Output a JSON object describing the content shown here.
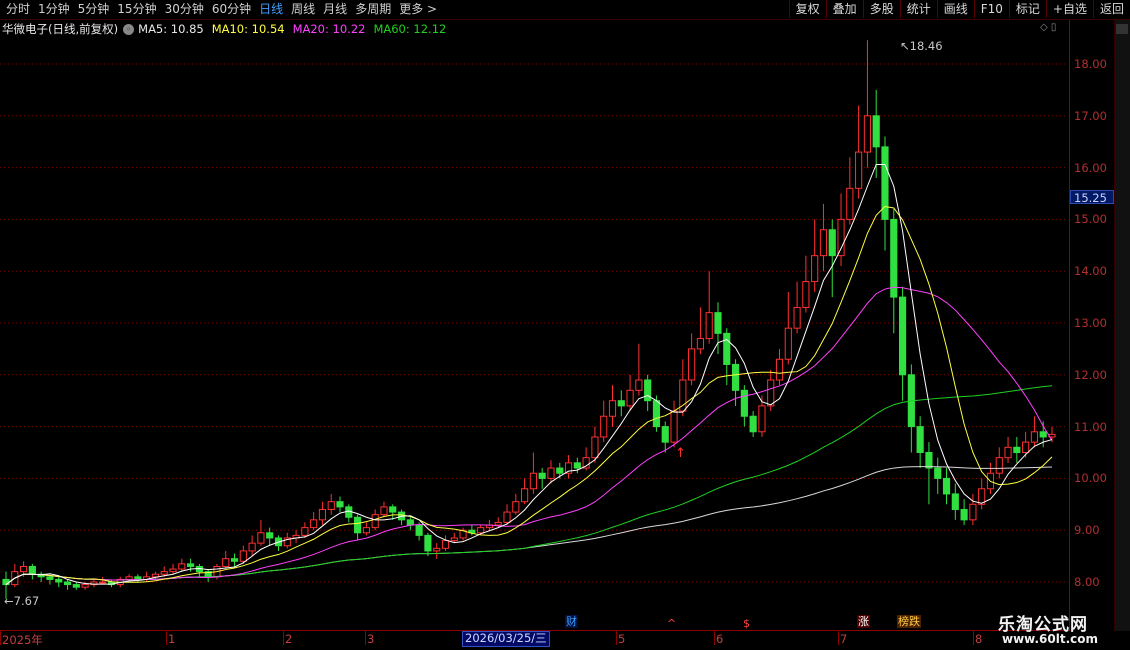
{
  "toolbar": {
    "periods": [
      "分时",
      "1分钟",
      "5分钟",
      "15分钟",
      "30分钟",
      "60分钟",
      "日线",
      "周线",
      "月线",
      "多周期",
      "更多 >"
    ],
    "active_period": "日线",
    "tools": [
      "复权",
      "叠加",
      "多股",
      "统计",
      "画线",
      "F10",
      "标记",
      "+自选",
      "返回"
    ]
  },
  "stock": {
    "name": "华微电子(日线,前复权)",
    "ma_toggle": "◦",
    "ma5": "MA5: 10.85",
    "ma10": "MA10: 10.54",
    "ma20": "MA20: 10.22",
    "ma60": "MA60: 12.12",
    "current_price": "15.25",
    "high_label": "18.46",
    "low_label": "7.67",
    "corner_icons": "◇ ▯"
  },
  "colors": {
    "up": "#ff3030",
    "down": "#30e040",
    "ma5": "#ffffff",
    "ma10": "#ffff40",
    "ma20": "#ff40ff",
    "ma60": "#20d020",
    "ma120": "#d8d8d8",
    "grid": "#7a0000"
  },
  "price_axis": [
    "18.00",
    "17.00",
    "16.00",
    "15.00",
    "14.00",
    "13.00",
    "12.00",
    "11.00",
    "10.00",
    "9.00",
    "8.00"
  ],
  "time_axis": [
    "2025年",
    "1",
    "2",
    "3",
    "5",
    "6",
    "7",
    "8"
  ],
  "selected_date": "2026/03/25/三",
  "markers": [
    "财",
    "^",
    "$",
    "涨",
    "榜跌"
  ],
  "watermark": {
    "title": "乐淘公式网",
    "url": "www.60lt.com"
  },
  "chart_data": {
    "type": "candlestick",
    "ylim": [
      7.5,
      18.6
    ],
    "series_note": "daily OHLC sampled",
    "candles": [
      [
        8.05,
        7.95,
        8.2,
        7.67
      ],
      [
        7.95,
        8.2,
        8.35,
        7.9
      ],
      [
        8.2,
        8.3,
        8.4,
        8.1
      ],
      [
        8.3,
        8.15,
        8.35,
        8.05
      ],
      [
        8.15,
        8.1,
        8.2,
        8.0
      ],
      [
        8.1,
        8.05,
        8.15,
        7.95
      ],
      [
        8.05,
        8.0,
        8.1,
        7.9
      ],
      [
        8.0,
        7.95,
        8.05,
        7.85
      ],
      [
        7.95,
        7.9,
        8.0,
        7.85
      ],
      [
        7.9,
        7.95,
        8.0,
        7.85
      ],
      [
        7.95,
        8.0,
        8.05,
        7.9
      ],
      [
        8.0,
        8.0,
        8.1,
        7.95
      ],
      [
        8.0,
        7.95,
        8.05,
        7.9
      ],
      [
        7.95,
        8.05,
        8.1,
        7.9
      ],
      [
        8.05,
        8.1,
        8.15,
        8.0
      ],
      [
        8.1,
        8.05,
        8.15,
        8.0
      ],
      [
        8.05,
        8.1,
        8.2,
        8.0
      ],
      [
        8.1,
        8.15,
        8.2,
        8.05
      ],
      [
        8.15,
        8.2,
        8.3,
        8.1
      ],
      [
        8.2,
        8.25,
        8.35,
        8.15
      ],
      [
        8.25,
        8.35,
        8.45,
        8.2
      ],
      [
        8.35,
        8.3,
        8.45,
        8.2
      ],
      [
        8.3,
        8.2,
        8.35,
        8.1
      ],
      [
        8.2,
        8.1,
        8.25,
        8.0
      ],
      [
        8.1,
        8.3,
        8.35,
        8.05
      ],
      [
        8.3,
        8.45,
        8.6,
        8.25
      ],
      [
        8.45,
        8.4,
        8.55,
        8.3
      ],
      [
        8.4,
        8.6,
        8.7,
        8.35
      ],
      [
        8.6,
        8.75,
        8.9,
        8.5
      ],
      [
        8.75,
        8.95,
        9.2,
        8.7
      ],
      [
        8.95,
        8.85,
        9.05,
        8.7
      ],
      [
        8.85,
        8.7,
        8.9,
        8.6
      ],
      [
        8.7,
        8.85,
        8.95,
        8.65
      ],
      [
        8.85,
        8.9,
        9.0,
        8.75
      ],
      [
        8.9,
        9.05,
        9.15,
        8.85
      ],
      [
        9.05,
        9.2,
        9.35,
        9.0
      ],
      [
        9.2,
        9.4,
        9.55,
        9.1
      ],
      [
        9.4,
        9.55,
        9.7,
        9.3
      ],
      [
        9.55,
        9.45,
        9.65,
        9.35
      ],
      [
        9.45,
        9.25,
        9.5,
        9.15
      ],
      [
        9.25,
        8.95,
        9.3,
        8.8
      ],
      [
        8.95,
        9.05,
        9.15,
        8.9
      ],
      [
        9.05,
        9.3,
        9.4,
        9.0
      ],
      [
        9.3,
        9.45,
        9.55,
        9.25
      ],
      [
        9.45,
        9.35,
        9.5,
        9.2
      ],
      [
        9.35,
        9.2,
        9.4,
        9.1
      ],
      [
        9.2,
        9.1,
        9.25,
        9.0
      ],
      [
        9.1,
        8.9,
        9.15,
        8.8
      ],
      [
        8.9,
        8.6,
        8.95,
        8.5
      ],
      [
        8.6,
        8.65,
        8.75,
        8.45
      ],
      [
        8.65,
        8.8,
        8.9,
        8.6
      ],
      [
        8.8,
        8.85,
        8.95,
        8.75
      ],
      [
        8.85,
        9.0,
        9.05,
        8.8
      ],
      [
        9.0,
        8.95,
        9.1,
        8.9
      ],
      [
        8.95,
        9.05,
        9.1,
        8.9
      ],
      [
        9.05,
        9.1,
        9.2,
        9.0
      ],
      [
        9.1,
        9.15,
        9.25,
        9.05
      ],
      [
        9.15,
        9.35,
        9.5,
        9.1
      ],
      [
        9.35,
        9.55,
        9.7,
        9.3
      ],
      [
        9.55,
        9.8,
        10.0,
        9.5
      ],
      [
        9.8,
        10.1,
        10.5,
        9.7
      ],
      [
        10.1,
        10.0,
        10.2,
        9.8
      ],
      [
        10.0,
        10.2,
        10.35,
        9.9
      ],
      [
        10.2,
        10.1,
        10.3,
        10.0
      ],
      [
        10.1,
        10.3,
        10.45,
        10.0
      ],
      [
        10.3,
        10.2,
        10.4,
        10.1
      ],
      [
        10.2,
        10.4,
        10.6,
        10.15
      ],
      [
        10.4,
        10.8,
        11.0,
        10.3
      ],
      [
        10.8,
        11.2,
        11.5,
        10.7
      ],
      [
        11.2,
        11.5,
        11.8,
        11.0
      ],
      [
        11.5,
        11.4,
        11.7,
        11.2
      ],
      [
        11.4,
        11.7,
        12.0,
        11.3
      ],
      [
        11.7,
        11.9,
        12.6,
        11.6
      ],
      [
        11.9,
        11.5,
        12.0,
        11.3
      ],
      [
        11.5,
        11.0,
        11.6,
        10.9
      ],
      [
        11.0,
        10.7,
        11.1,
        10.5
      ],
      [
        10.7,
        11.3,
        11.5,
        10.6
      ],
      [
        11.3,
        11.9,
        12.3,
        11.2
      ],
      [
        11.9,
        12.5,
        12.8,
        11.8
      ],
      [
        12.5,
        12.7,
        13.3,
        12.4
      ],
      [
        12.7,
        13.2,
        14.0,
        12.6
      ],
      [
        13.2,
        12.8,
        13.4,
        12.4
      ],
      [
        12.8,
        12.2,
        12.9,
        11.8
      ],
      [
        12.2,
        11.7,
        12.3,
        11.4
      ],
      [
        11.7,
        11.2,
        11.8,
        11.0
      ],
      [
        11.2,
        10.9,
        11.3,
        10.8
      ],
      [
        10.9,
        11.4,
        11.6,
        10.8
      ],
      [
        11.4,
        11.9,
        12.1,
        11.3
      ],
      [
        11.9,
        12.3,
        12.5,
        11.8
      ],
      [
        12.3,
        12.9,
        13.6,
        12.2
      ],
      [
        12.9,
        13.3,
        13.8,
        12.8
      ],
      [
        13.3,
        13.8,
        14.3,
        13.2
      ],
      [
        13.8,
        14.3,
        15.0,
        13.6
      ],
      [
        14.3,
        14.8,
        15.3,
        14.0
      ],
      [
        14.8,
        14.3,
        15.0,
        13.5
      ],
      [
        14.3,
        15.0,
        15.5,
        14.1
      ],
      [
        15.0,
        15.6,
        16.2,
        14.9
      ],
      [
        15.6,
        16.3,
        17.2,
        15.4
      ],
      [
        16.3,
        17.0,
        18.46,
        16.0
      ],
      [
        17.0,
        16.4,
        17.5,
        15.8
      ],
      [
        16.4,
        15.0,
        16.6,
        14.4
      ],
      [
        15.0,
        13.5,
        15.2,
        12.8
      ],
      [
        13.5,
        12.0,
        13.7,
        11.5
      ],
      [
        12.0,
        11.0,
        12.2,
        10.5
      ],
      [
        11.0,
        10.5,
        11.2,
        10.2
      ],
      [
        10.5,
        10.2,
        10.7,
        9.5
      ],
      [
        10.2,
        10.0,
        10.4,
        9.7
      ],
      [
        10.0,
        9.7,
        10.2,
        9.5
      ],
      [
        9.7,
        9.4,
        9.9,
        9.2
      ],
      [
        9.4,
        9.2,
        9.6,
        9.1
      ],
      [
        9.2,
        9.5,
        9.7,
        9.1
      ],
      [
        9.5,
        9.8,
        10.0,
        9.4
      ],
      [
        9.8,
        10.1,
        10.3,
        9.7
      ],
      [
        10.1,
        10.4,
        10.6,
        10.0
      ],
      [
        10.4,
        10.6,
        10.8,
        10.3
      ],
      [
        10.6,
        10.5,
        10.8,
        10.3
      ],
      [
        10.5,
        10.7,
        10.9,
        10.4
      ],
      [
        10.7,
        10.9,
        11.2,
        10.6
      ],
      [
        10.9,
        10.8,
        11.1,
        10.6
      ],
      [
        10.8,
        10.85,
        11.0,
        10.7
      ]
    ],
    "xlabel": "",
    "ylabel": ""
  }
}
